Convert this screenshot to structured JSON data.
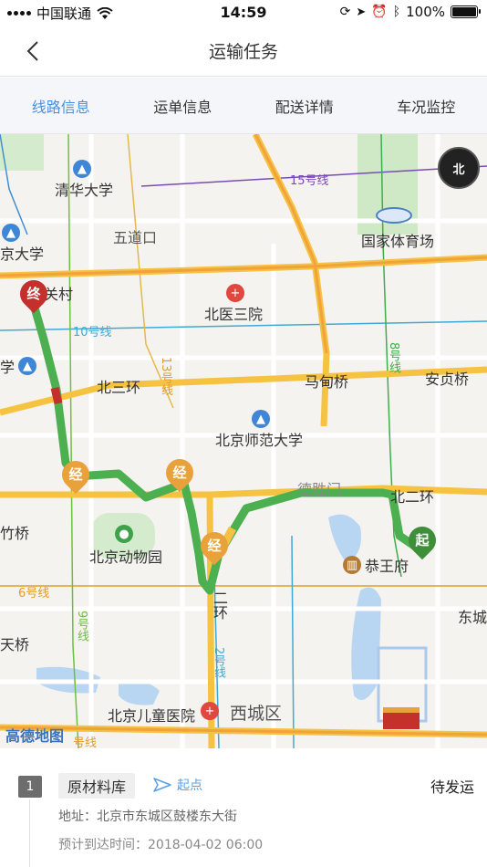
{
  "status_bar": {
    "carrier": "中国联通",
    "time": "14:59",
    "battery": "100%"
  },
  "nav": {
    "title": "运输任务"
  },
  "tabs": [
    {
      "label": "线路信息",
      "active": true
    },
    {
      "label": "运单信息",
      "active": false
    },
    {
      "label": "配送详情",
      "active": false
    },
    {
      "label": "车况监控",
      "active": false
    }
  ],
  "map": {
    "compass_label": "北",
    "watermark": "高德地图",
    "labels": {
      "tsinghua": "清华大学",
      "wudaokou": "五道口",
      "jingdaxue": "京大学",
      "guanchun": "关村",
      "beiyisanyuan": "北医三院",
      "xue": "学",
      "beisanhuan": "北三环",
      "madianqiao": "马甸桥",
      "anzhenqiao": "安贞桥",
      "bnu": "北京师范大学",
      "deshengmen": "德胜门",
      "beierhuan": "北二环",
      "zhuqiao": "竹桥",
      "zoo": "北京动物园",
      "gongwangfu": "恭王府",
      "tianqiao": "天桥",
      "erhuan": "二环",
      "childrens_hospital": "北京儿童医院",
      "xicheng": "西城区",
      "dong": "东城",
      "stadium": "国家体育场"
    },
    "lines": {
      "line15": "15号线",
      "line10": "10号线",
      "line8": "8号线",
      "line13": "13号线",
      "line6": "6号线",
      "line9": "9号线",
      "line2": "2号线",
      "line4": "号线"
    },
    "markers": {
      "start": "起",
      "end": "终",
      "via": "经"
    }
  },
  "task": {
    "seq": "1",
    "location": "原材料库",
    "point_type": "起点",
    "status": "待发运",
    "address": "地址：北京市东城区鼓楼东大街",
    "eta": "预计到达时间：2018-04-02 06:00"
  },
  "colors": {
    "accent": "#4a90e2",
    "route": "#4caf50",
    "ring_road": "#f5c242",
    "start_marker": "#3f8f3a",
    "end_marker": "#c4302b",
    "via_marker": "#e9a23b"
  }
}
